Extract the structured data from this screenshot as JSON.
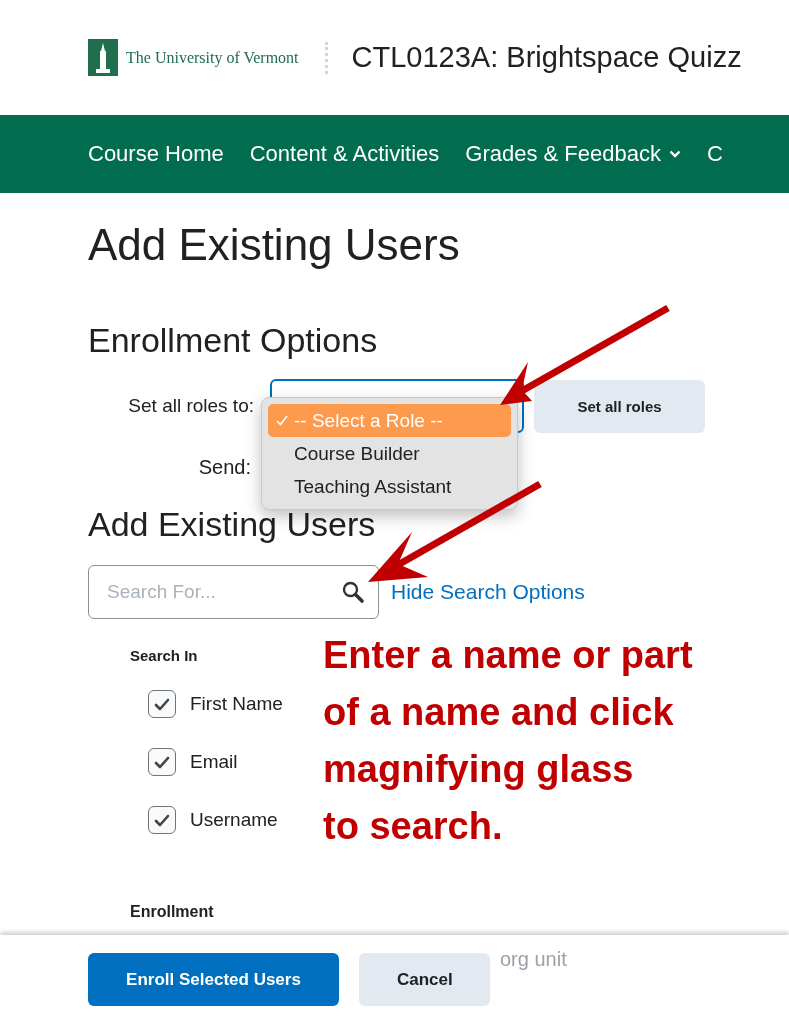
{
  "header": {
    "logo_text": "The University of Vermont",
    "course_title": "CTL0123A: Brightspace Quizz"
  },
  "nav": [
    {
      "label": "Course Home",
      "has_menu": false
    },
    {
      "label": "Content & Activities",
      "has_menu": false
    },
    {
      "label": "Grades & Feedback",
      "has_menu": true
    },
    {
      "label": "C",
      "has_menu": false
    }
  ],
  "page_title": "Add Existing Users",
  "enrollment_options": {
    "heading": "Enrollment Options",
    "role_label": "Set all roles to:",
    "role_options": [
      {
        "label": "-- Select a Role --",
        "selected": true
      },
      {
        "label": "Course Builder",
        "selected": false
      },
      {
        "label": "Teaching Assistant",
        "selected": false
      }
    ],
    "set_button": "Set all roles",
    "send_label": "Send:"
  },
  "add_users": {
    "heading": "Add Existing Users",
    "search": {
      "placeholder": "Search For..."
    },
    "toggle_link": "Hide Search Options",
    "search_in_label": "Search In",
    "search_in": [
      {
        "label": "First Name",
        "checked": true
      },
      {
        "label": "Email",
        "checked": true
      },
      {
        "label": "Username",
        "checked": true
      }
    ],
    "enrollment_label": "Enrollment",
    "faded_option": "org unit"
  },
  "annotation": {
    "lines": [
      "Enter a name or part",
      "of a name and click",
      "magnifying glass",
      "to search."
    ]
  },
  "footer": {
    "buttons": [
      {
        "label": "Enroll Selected Users",
        "kind": "primary"
      },
      {
        "label": "Cancel",
        "kind": "secondary"
      }
    ]
  }
}
